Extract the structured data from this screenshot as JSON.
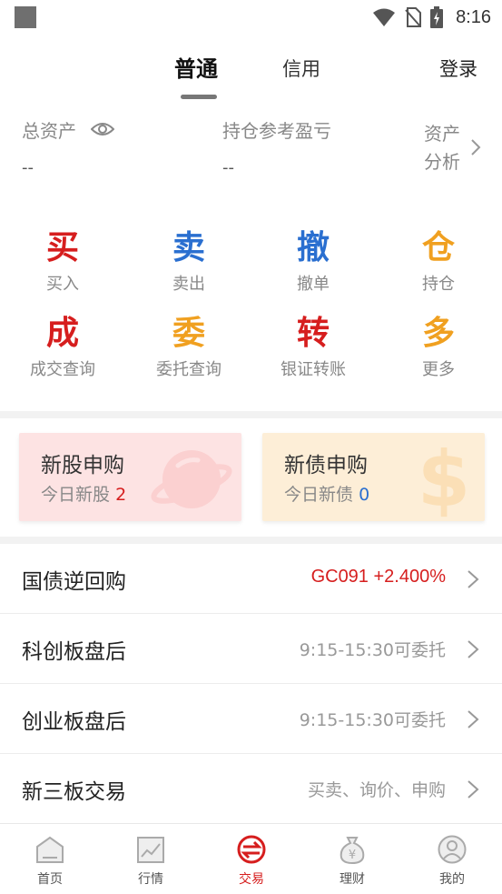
{
  "status_bar": {
    "time": "8:16"
  },
  "header": {
    "tabs": [
      {
        "label": "普通",
        "active": true
      },
      {
        "label": "信用",
        "active": false
      }
    ],
    "login_label": "登录"
  },
  "assets": {
    "total_label": "总资产",
    "total_value": "--",
    "pnl_label": "持仓参考盈亏",
    "pnl_value": "--",
    "analysis_label": "资产分析"
  },
  "actions": [
    {
      "glyph": "买",
      "label": "买入",
      "color": "#d61e1e"
    },
    {
      "glyph": "卖",
      "label": "卖出",
      "color": "#2a6fd0"
    },
    {
      "glyph": "撤",
      "label": "撤单",
      "color": "#2a6fd0"
    },
    {
      "glyph": "仓",
      "label": "持仓",
      "color": "#f0a020"
    },
    {
      "glyph": "成",
      "label": "成交查询",
      "color": "#d61e1e"
    },
    {
      "glyph": "委",
      "label": "委托查询",
      "color": "#f0a020"
    },
    {
      "glyph": "转",
      "label": "银证转账",
      "color": "#d61e1e"
    },
    {
      "glyph": "多",
      "label": "更多",
      "color": "#f0a020"
    }
  ],
  "cards": {
    "ipo": {
      "title": "新股申购",
      "sub_label": "今日新股",
      "count": "2"
    },
    "bond": {
      "title": "新债申购",
      "sub_label": "今日新债",
      "count": "0"
    }
  },
  "list": [
    {
      "title": "国债逆回购",
      "detail": "GC091 +2.400%",
      "highlight": true
    },
    {
      "title": "科创板盘后",
      "detail": "9:15-15:30可委托",
      "highlight": false
    },
    {
      "title": "创业板盘后",
      "detail": "9:15-15:30可委托",
      "highlight": false
    },
    {
      "title": "新三板交易",
      "detail": "买卖、询价、申购",
      "highlight": false
    }
  ],
  "bottom_nav": [
    {
      "label": "首页",
      "icon": "home-icon",
      "active": false
    },
    {
      "label": "行情",
      "icon": "chart-icon",
      "active": false
    },
    {
      "label": "交易",
      "icon": "trade-icon",
      "active": true
    },
    {
      "label": "理财",
      "icon": "money-bag-icon",
      "active": false
    },
    {
      "label": "我的",
      "icon": "user-icon",
      "active": false
    }
  ],
  "colors": {
    "accent_red": "#d61e1e",
    "accent_blue": "#2a6fd0",
    "accent_orange": "#f0a020"
  }
}
